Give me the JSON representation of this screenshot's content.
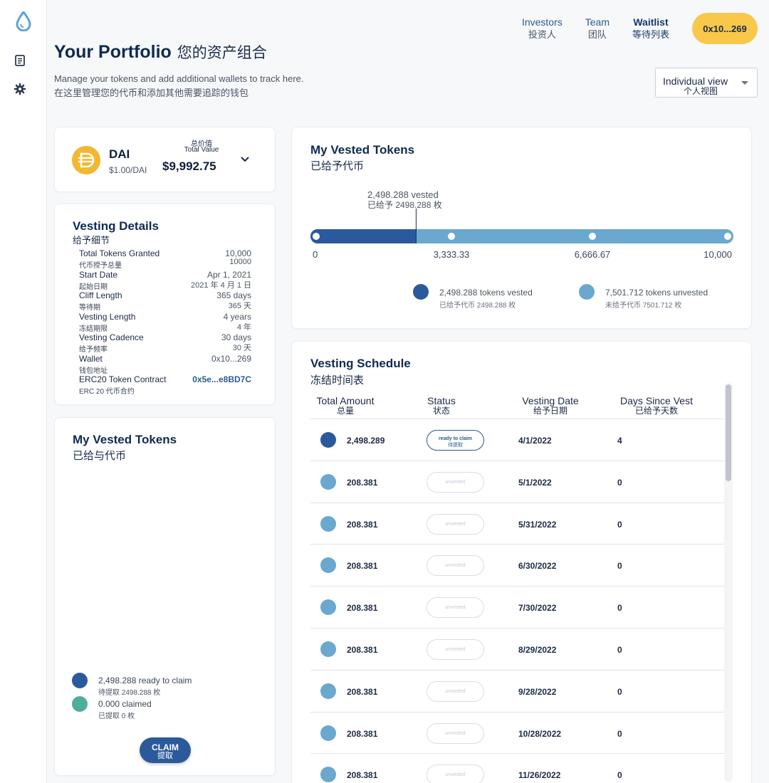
{
  "nav": {
    "items": [
      {
        "en": "Investors",
        "zh": "投资人"
      },
      {
        "en": "Team",
        "zh": "团队"
      },
      {
        "en": "Waitlist",
        "zh": "等待列表"
      }
    ],
    "wallet": "0x10...269"
  },
  "header": {
    "title": "Your Portfolio",
    "title_zh": "您的资产组合",
    "subtitle": "Manage your tokens and add additional wallets to track here.",
    "subtitle_zh": "在这里管理您的代币和添加其他需要追踪的钱包",
    "view_select": "Individual view",
    "view_select_zh": "个人视图"
  },
  "token": {
    "symbol": "DAI",
    "price": "$1.00/DAI",
    "total_value_zh": "总价值",
    "total_value_label": "Total Value",
    "total_value": "$9,992.75"
  },
  "details": {
    "title": "Vesting Details",
    "title_zh": "给予细节",
    "rows": [
      {
        "label": "Total Tokens Granted",
        "label_zh": "代币授予总量",
        "value": "10,000",
        "value_zh": "10000"
      },
      {
        "label": "Start Date",
        "label_zh": "起始日期",
        "value": "Apr 1, 2021",
        "value_zh": "2021 年 4 月 1 日"
      },
      {
        "label": "Cliff Length",
        "label_zh": "等待期",
        "value": "365 days",
        "value_zh": "365 天"
      },
      {
        "label": "Vesting Length",
        "label_zh": "冻结期限",
        "value": "4 years",
        "value_zh": "4 年"
      },
      {
        "label": "Vesting Cadence",
        "label_zh": "给予频率",
        "value": "30 days",
        "value_zh": "30 天"
      },
      {
        "label": "Wallet",
        "label_zh": "钱包地址",
        "value": "0x10...269",
        "value_zh": ""
      },
      {
        "label": "ERC20 Token Contract",
        "label_zh": "ERC 20 代币合约",
        "value": "0x5e...e8BD7C",
        "value_zh": ""
      }
    ]
  },
  "left_vested": {
    "title": "My Vested Tokens",
    "title_zh": "已给与代币",
    "ready": "2,498.288 ready to claim",
    "ready_zh": "待提取 2498.288 枚",
    "claimed": "0.000 claimed",
    "claimed_zh": "已提取 0 枚",
    "claim_btn": "CLAIM",
    "claim_btn_zh": "提取"
  },
  "right_vested": {
    "title": "My Vested Tokens",
    "title_zh": "已给予代币",
    "marker_label": "2,498.288 vested",
    "marker_label_zh": "已给予 2498.288 枚",
    "legend_vested": "2,498.288 tokens vested",
    "legend_vested_zh": "已给予代币 2498.288 枚",
    "legend_unvested": "7,501.712 tokens unvested",
    "legend_unvested_zh": "未给予代币 7501.712 枚"
  },
  "chart_data": {
    "type": "bar",
    "orientation": "horizontal-progress",
    "x_ticks": [
      "0",
      "3,333.33",
      "6,666.67",
      "10,000"
    ],
    "xlim": [
      0,
      10000
    ],
    "vested": 2498.288,
    "unvested": 7501.712,
    "total": 10000
  },
  "colors": {
    "vested": "#2a5a9c",
    "unvested": "#6aa8cf",
    "claimed": "#4fae9a",
    "accent": "#f9c84a"
  },
  "schedule": {
    "title": "Vesting Schedule",
    "title_zh": "冻结时间表",
    "headers": [
      {
        "en": "Total Amount",
        "zh": "总量"
      },
      {
        "en": "Status",
        "zh": "状态"
      },
      {
        "en": "Vesting Date",
        "zh": "给予日期"
      },
      {
        "en": "Days Since Vest",
        "zh": "已给予天数"
      }
    ],
    "rows": [
      {
        "amount": "2,498.289",
        "status": "ready to claim",
        "status_zh": "待提取",
        "state": "vested",
        "date": "4/1/2022",
        "days": "4"
      },
      {
        "amount": "208.381",
        "status": "unvested",
        "status_zh": "",
        "state": "unvested",
        "date": "5/1/2022",
        "days": "0"
      },
      {
        "amount": "208.381",
        "status": "unvested",
        "status_zh": "",
        "state": "unvested",
        "date": "5/31/2022",
        "days": "0"
      },
      {
        "amount": "208.381",
        "status": "unvested",
        "status_zh": "",
        "state": "unvested",
        "date": "6/30/2022",
        "days": "0"
      },
      {
        "amount": "208.381",
        "status": "unvested",
        "status_zh": "",
        "state": "unvested",
        "date": "7/30/2022",
        "days": "0"
      },
      {
        "amount": "208.381",
        "status": "unvested",
        "status_zh": "",
        "state": "unvested",
        "date": "8/29/2022",
        "days": "0"
      },
      {
        "amount": "208.381",
        "status": "unvested",
        "status_zh": "",
        "state": "unvested",
        "date": "9/28/2022",
        "days": "0"
      },
      {
        "amount": "208.381",
        "status": "unvested",
        "status_zh": "",
        "state": "unvested",
        "date": "10/28/2022",
        "days": "0"
      },
      {
        "amount": "208.381",
        "status": "unvested",
        "status_zh": "",
        "state": "unvested",
        "date": "11/26/2022",
        "days": "0"
      }
    ]
  }
}
